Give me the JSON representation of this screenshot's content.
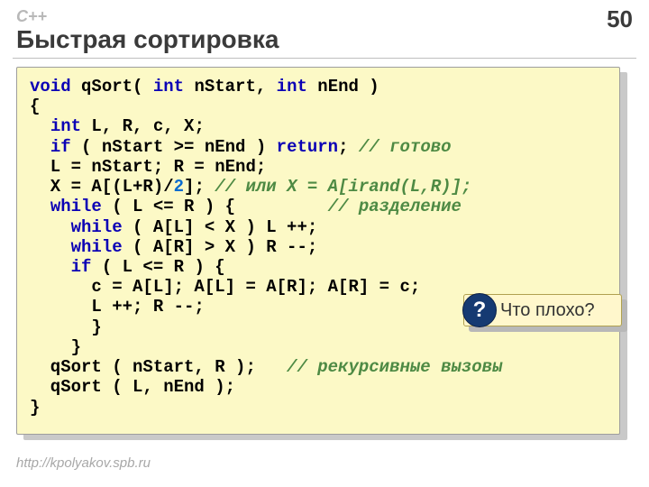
{
  "header": {
    "lang": "C++",
    "page": "50",
    "title": "Быстрая сортировка"
  },
  "code": {
    "l1": {
      "a": "void",
      "b": " qSort( ",
      "c": "int",
      "d": " nStart, ",
      "e": "int",
      "f": " nEnd )"
    },
    "l2": "{",
    "l3": {
      "a": "  ",
      "b": "int",
      "c": " L, R, c, X;"
    },
    "l4": {
      "a": "  ",
      "b": "if",
      "c": " ( nStart >= nEnd ) ",
      "d": "return",
      "e": "; ",
      "f": "// готово"
    },
    "l5": "  L = nStart; R = nEnd;",
    "l6": {
      "a": "  X = A[(L+R)/",
      "b": "2",
      "c": "]; ",
      "d": "// или X = A[irand(L,R)];"
    },
    "l7": {
      "a": "  ",
      "b": "while",
      "c": " ( L <= R ) {         ",
      "d": "// разделение"
    },
    "l8": {
      "a": "    ",
      "b": "while",
      "c": " ( A[L] < X ) L ++;"
    },
    "l9": {
      "a": "    ",
      "b": "while",
      "c": " ( A[R] > X ) R --;"
    },
    "l10": {
      "a": "    ",
      "b": "if",
      "c": " ( L <= R ) {"
    },
    "l11": "      c = A[L]; A[L] = A[R]; A[R] = c;",
    "l12": "      L ++; R --;",
    "l13": "      }",
    "l14": "    }",
    "l15": {
      "a": "  qSort ( nStart, R );   ",
      "b": "// рекурсивные вызовы"
    },
    "l16": "  qSort ( L, nEnd );",
    "l17": "}"
  },
  "callout": {
    "badge": "?",
    "text": "Что плохо?"
  },
  "footer": {
    "url": "http://kpolyakov.spb.ru"
  }
}
